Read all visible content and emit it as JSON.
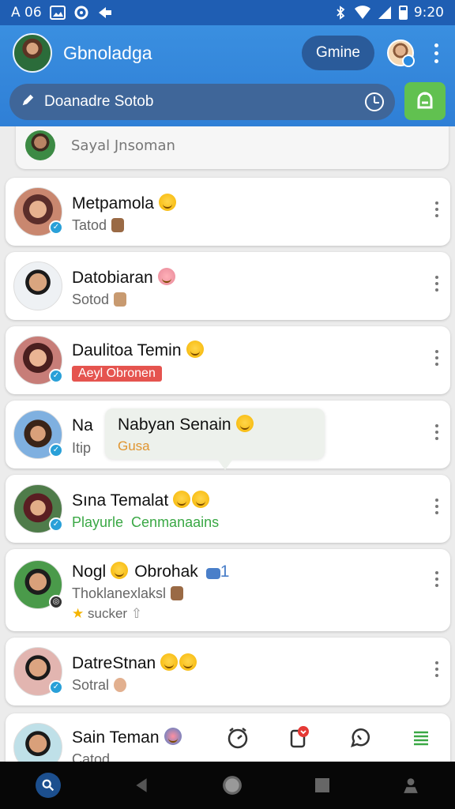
{
  "status_bar": {
    "left_text": "A 06",
    "time": "9:20"
  },
  "header": {
    "title": "Gbnoladga",
    "online_label": "Gmine",
    "search_value": "Doanadre Sotob"
  },
  "top_item": {
    "label": "Sayal Jnsoman"
  },
  "chats": [
    {
      "name": "Metpamola",
      "sub": "Tatod"
    },
    {
      "name": "Datobiaran",
      "sub": "Sotod"
    },
    {
      "name": "Daulitoa Temin",
      "sub": "Aeyl Obronen"
    },
    {
      "name": "Na",
      "sub": "Itip"
    },
    {
      "name": "Sına Temalat",
      "sub_a": "Playurle",
      "sub_b": "Cenmanaains"
    },
    {
      "name": "Nogl",
      "name_b": "Obrohak",
      "count": "1",
      "sub": "Thoklanexlaksl",
      "sub2": "sucker"
    },
    {
      "name": "DatreStnan",
      "sub": "Sotral"
    },
    {
      "name": "Sain Teman",
      "sub": "Catod"
    }
  ],
  "popup": {
    "name": "Nabyan Senain",
    "sub": "Gusa"
  },
  "colors": {
    "primary": "#2f7fd6",
    "accent_green": "#61c150",
    "verified": "#29a0d8"
  }
}
